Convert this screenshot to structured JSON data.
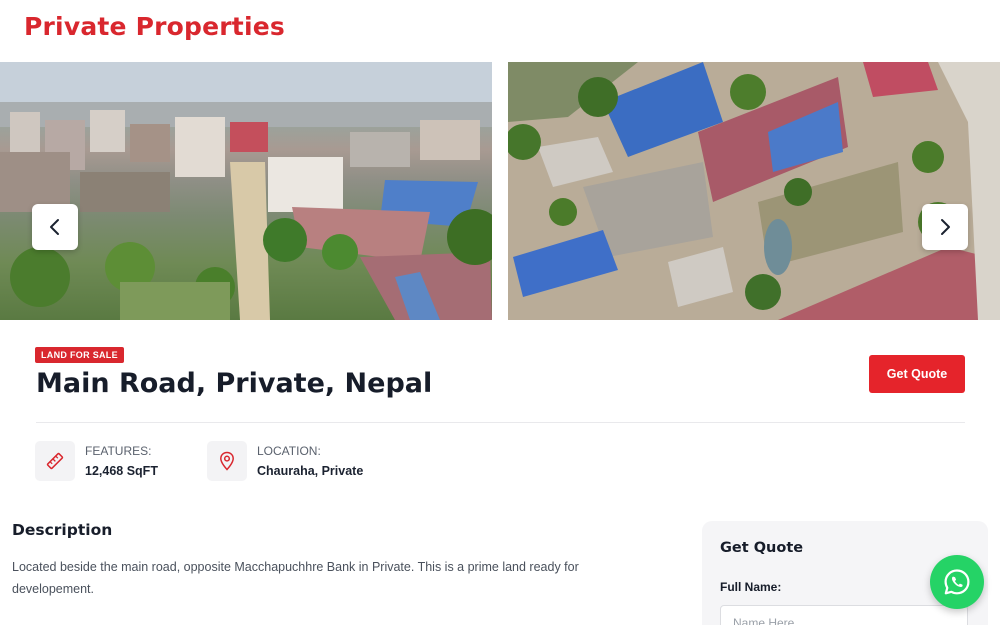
{
  "site": {
    "brand": "Private Properties"
  },
  "gallery": {
    "prev_icon": "chevron-left-icon",
    "next_icon": "chevron-right-icon"
  },
  "listing": {
    "badge": "LAND FOR SALE",
    "title": "Main Road, Private, Nepal",
    "quote_button": "Get Quote",
    "features": [
      {
        "icon": "ruler-icon",
        "label": "FEATURES:",
        "value": "12,468 SqFT"
      },
      {
        "icon": "location-pin-icon",
        "label": "LOCATION:",
        "value": "Chauraha, Private"
      }
    ]
  },
  "description": {
    "heading": "Description",
    "text": "Located beside the main road, opposite Macchapuchhre Bank in Private. This is a prime land ready for developement."
  },
  "quote_form": {
    "title": "Get Quote",
    "name_label": "Full Name:",
    "name_placeholder": "Name Here"
  },
  "colors": {
    "brand_red": "#d9272e",
    "button_red": "#e5242b",
    "whatsapp_green": "#25d366"
  }
}
